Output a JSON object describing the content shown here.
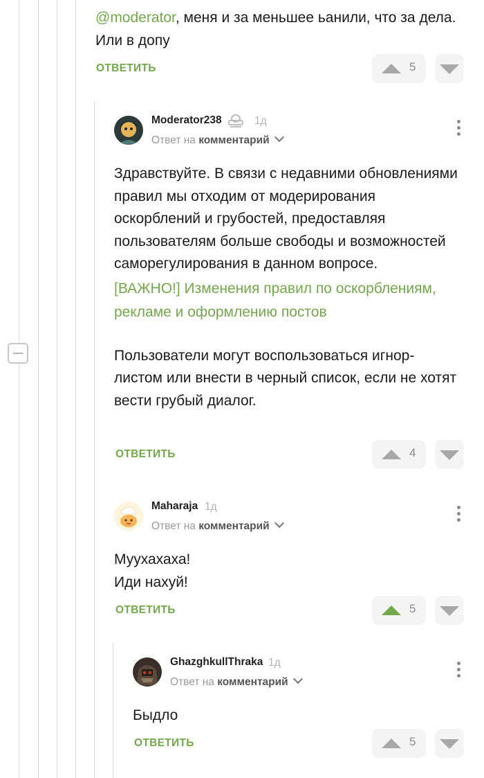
{
  "thread": {
    "collapse_label": "−"
  },
  "c0": {
    "mention": "@moderator",
    "text_line1": ", меня и за меньшее ьанили, что за дела.",
    "text_line2": "Или в допу",
    "reply": "ОТВЕТИТЬ",
    "votes": "5"
  },
  "c1": {
    "author": "Moderator238",
    "badge_icon": "moderator-badge-icon",
    "time": "1д",
    "meta_prefix": "Ответ на",
    "meta_target": "комментарий",
    "paragraph1": "Здравствуйте. В связи с недавними обновлениями правил мы отходим от модерирования оскорблений и грубостей, предоставляя пользователям больше свободы и возможностей саморегулирования в данном вопросе.",
    "link": "[ВАЖНО!] Изменения правил по оскорблениям, рекламе и оформлению постов",
    "paragraph2": "Пользователи могут воспользоваться игнор-листом или внести в черный список, если не хотят вести грубый диалог.",
    "reply": "ОТВЕТИТЬ",
    "votes": "4"
  },
  "c2": {
    "author": "Maharaja",
    "time": "1д",
    "meta_prefix": "Ответ на",
    "meta_target": "комментарий",
    "line1": "Муухахаха!",
    "line2": "Иди нахуй!",
    "reply": "ОТВЕТИТЬ",
    "votes": "5",
    "upvoted": true
  },
  "c3": {
    "author": "GhazghkullThraka",
    "time": "1д",
    "meta_prefix": "Ответ на",
    "meta_target": "комментарий",
    "text": "Быдло",
    "reply": "ОТВЕТИТЬ",
    "votes": "5"
  },
  "colors": {
    "accent": "#73a84b",
    "thread_line": "#d9d9d9",
    "vote_bg": "#f4f4f4"
  }
}
